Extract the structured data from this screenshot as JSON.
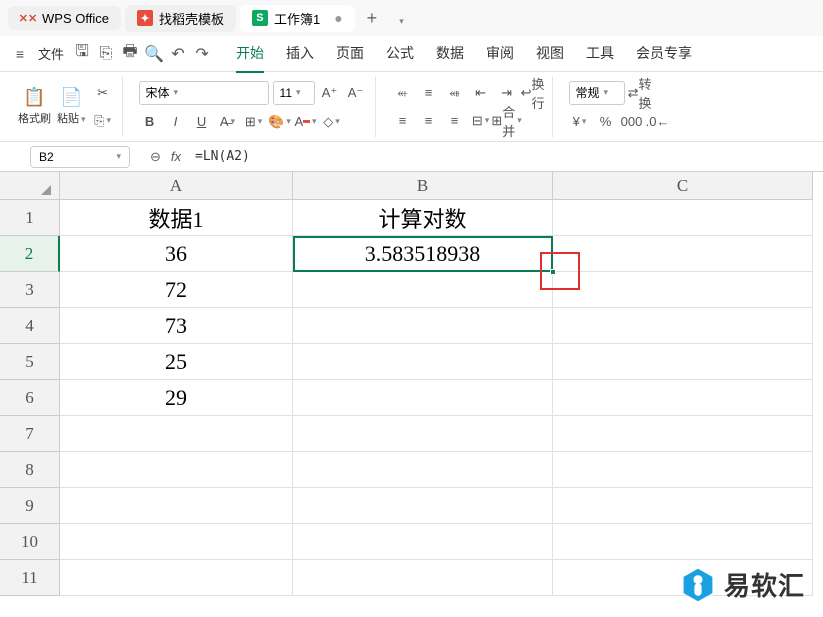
{
  "titlebar": {
    "app_name": "WPS Office",
    "tabs": [
      {
        "icon": "dk",
        "label": "找稻壳模板"
      },
      {
        "icon": "s",
        "label": "工作簿1",
        "dirty": "●"
      }
    ]
  },
  "menubar": {
    "file": "文件",
    "tabs": [
      "开始",
      "插入",
      "页面",
      "公式",
      "数据",
      "审阅",
      "视图",
      "工具",
      "会员专享"
    ],
    "active": 0
  },
  "toolbar": {
    "format_painter": "格式刷",
    "paste": "粘贴",
    "font_name": "宋体",
    "font_size": "11",
    "wrap": "换行",
    "merge": "合并",
    "number_format": "常规",
    "convert": "转换"
  },
  "formula_bar": {
    "name_box": "B2",
    "formula": "=LN(A2)"
  },
  "grid": {
    "col_widths": {
      "A": 233,
      "B": 260,
      "C": 260
    },
    "columns": [
      "A",
      "B",
      "C"
    ],
    "row_count": 11,
    "selected_cell": "B2",
    "data": {
      "A1": "数据1",
      "B1": "计算对数",
      "A2": "36",
      "B2": "3.583518938",
      "A3": "72",
      "A4": "73",
      "A5": "25",
      "A6": "29"
    }
  },
  "watermark": {
    "text": "易软汇"
  },
  "chart_data": {
    "type": "table",
    "title": "",
    "columns": [
      "数据1",
      "计算对数"
    ],
    "rows": [
      [
        36,
        3.583518938
      ],
      [
        72,
        null
      ],
      [
        73,
        null
      ],
      [
        25,
        null
      ],
      [
        29,
        null
      ]
    ],
    "formula": "=LN(A2)"
  }
}
